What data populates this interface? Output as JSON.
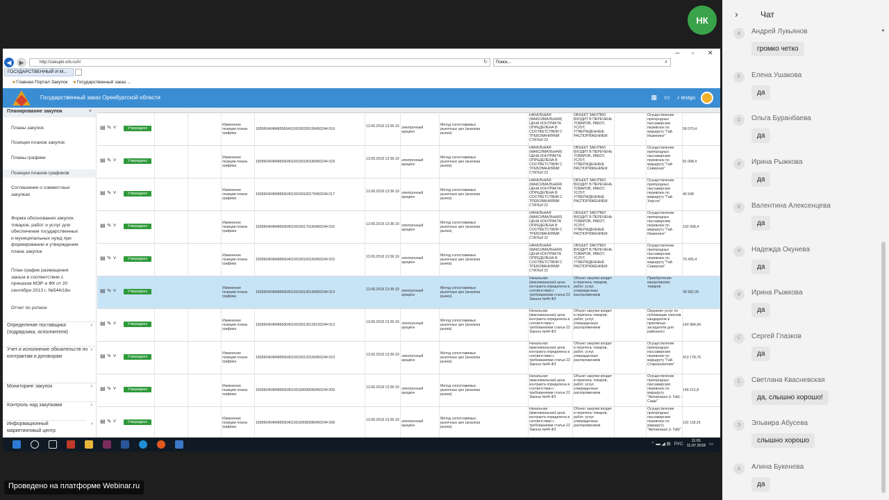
{
  "meeting": {
    "avatar_initials": "НК",
    "platform_label": "Проведено на платформе Webinar.ru"
  },
  "browser": {
    "url": "http://zakupki.orb.ru/#/",
    "search_placeholder": "Поиск...",
    "tabs": [
      "ГОСУДАРСТВЕННЫЙ И М...",
      "Государственный заказ ..."
    ],
    "favorites": [
      "Главная Портал Закупок",
      "Государственный заказ ..."
    ]
  },
  "app": {
    "title": "Государственный заказ Оренбургской области",
    "user": "testgo",
    "sidebar": {
      "group": "Планирование закупок",
      "items": [
        "Планы закупок",
        "Позиции планов закупок",
        "Планы-графики",
        "Позиции планов-графиков",
        "Соглашения о совместных закупках",
        "Форма обоснования закупок товаров, работ и услуг для обеспечения государственных и муниципальных нужд при формировании и утверждении плана закупок",
        "План-график размещения заказа в соответствии с приказом МЭР и ФК от 20 сентября 2013 г. №544/18н",
        "Отчет по рсписи"
      ],
      "sections": [
        "Определение поставщика (подрядчика, исполнителя)",
        "Учет и исполнение обязательств по контрактам и договорам",
        "Мониторинг закупок",
        "Контроль над закупками",
        "Информационный маркетинговый центр"
      ]
    },
    "table_rows": [
      {
        "status": "Утверждено",
        "type": "Изменение позиции плана-графика",
        "number": "183560404848556040100100200190450244 019",
        "date": "13.06.2018 13:36:19",
        "auction": "электронный аукцион",
        "method": "Метод сопоставимых рыночных цен (анализа рынка)",
        "nmc": "НАЧАЛЬНАЯ (МАКСИМАЛЬНАЯ) ЦЕНА КОНТРАКТА ОПРЕДЕЛЕНА В СООТВЕТСТВИИ С ТРЕБОВАНИЯМИ СТАТЬИ 22",
        "object": "ОБЪЕКТ ЗАКУПКИ ВХОДИТ В ПЕРЕЧЕНЬ ТОВАРОВ, РАБОТ, УСЛУГ, УТВЕРЖДЕННЫЕ РАСПОРЯЖЕНИЕМ",
        "desc": "Осуществление пригородных пассажирских перевозок по маршруту \"Гай-Ишкинино\"",
        "sum": "58 070,4"
      },
      {
        "status": "Утверждено",
        "type": "Изменение позиции плана-графика",
        "number": "183560404848556040100100180180450244 018",
        "date": "13.06.2018 13:36:19",
        "auction": "электронный аукцион",
        "method": "Метод сопоставимых рыночных цен (анализа рынка)",
        "nmc": "НАЧАЛЬНАЯ (МАКСИМАЛЬНАЯ) ЦЕНА КОНТРАКТА ОПРЕДЕЛЕНА В СООТВЕТСТВИИ С ТРЕБОВАНИЯМИ СТАТЬИ 22",
        "object": "ОБЪЕКТ ЗАКУПКИ ВХОДИТ В ПЕРЕЧЕНЬ ТОВАРОВ, РАБОТ, УСЛУГ, УТВЕРЖДЕННЫЕ РАСПОРЯЖЕНИЕМ",
        "desc": "Осуществление пригородных пассажирских перевозок по маршруту \"Гай-Северная\"",
        "sum": "81 098,4"
      },
      {
        "status": "Утверждено",
        "type": "Изменение позиции плана-графика",
        "number": "183560404848556040100100180170450244 017",
        "date": "13.06.2018 13:36:19",
        "auction": "электронный аукцион",
        "method": "Метод сопоставимых рыночных цен (анализа рынка)",
        "nmc": "НАЧАЛЬНАЯ (МАКСИМАЛЬНАЯ) ЦЕНА КОНТРАКТА ОПРЕДЕЛЕНА В СООТВЕТСТВИИ С ТРЕБОВАНИЯМИ СТАТЬИ 22",
        "object": "ОБЪЕКТ ЗАКУПКИ ВХОДИТ В ПЕРЕЧЕНЬ ТОВАРОВ, РАБОТ, УСЛУГ, УТВЕРЖДЕННЫЕ РАСПОРЯЖЕНИЕМ",
        "desc": "Осуществление пригородных пассажирских перевозок по маршруту \"Гай-Херсон\"",
        "sum": "46 548"
      },
      {
        "status": "Утверждено",
        "type": "Изменение позиции плана-графика",
        "number": "183560404848556040100100170160450244 016",
        "date": "13.06.2018 13:36:19",
        "auction": "электронный аукцион",
        "method": "Метод сопоставимых рыночных цен (анализа рынка)",
        "nmc": "НАЧАЛЬНАЯ (МАКСИМАЛЬНАЯ) ЦЕНА КОНТРАКТА ОПРЕДЕЛЕНА В СООТВЕТСТВИИ С ТРЕБОВАНИЯМИ СТАТЬИ 22",
        "object": "ОБЪЕКТ ЗАКУПКИ ВХОДИТ В ПЕРЕЧЕНЬ ТОВАРОВ, РАБОТ, УСЛУГ, УТВЕРЖДЕННЫЕ РАСПОРЯЖЕНИЕМ",
        "desc": "Осуществление пригородных пассажирских перевозок по маршруту \"Гай-Ишкинино\"",
        "sum": "102 438,4"
      },
      {
        "status": "Утверждено",
        "type": "Изменение позиции плана-графика",
        "number": "183560404848556040100100160150450244 015",
        "date": "13.06.2018 13:36:19",
        "auction": "электронный аукцион",
        "method": "Метод сопоставимых рыночных цен (анализа рынка)",
        "nmc": "НАЧАЛЬНАЯ (МАКСИМАЛЬНАЯ) ЦЕНА КОНТРАКТА ОПРЕДЕЛЕНА В СООТВЕТСТВИИ С ТРЕБОВАНИЯМИ СТАТЬИ 22",
        "object": "ОБЪЕКТ ЗАКУПКИ ВХОДИТ В ПЕРЕЧЕНЬ ТОВАРОВ, РАБОТ, УСЛУГ, УТВЕРЖДЕННЫЕ РАСПОРЯЖЕНИЕМ",
        "desc": "Осуществление пригородных пассажирских перевозок по маршруту \"Гай-Северная\"",
        "sum": "70 435,4"
      },
      {
        "status": "Утверждено",
        "type": "Изменение позиции плана-графика",
        "number": "183560404848556040100100140140000244 014",
        "date": "13.06.2018 13:36:19",
        "auction": "электронный аукцион",
        "method": "Метод сопоставимых рыночных цен (анализа рынка)",
        "nmc": "Начальная (максимальная) цена контракта определена в соответствии с требованиями статьи 22 Закона №44-ФЗ",
        "object": "Объект закупки входит в перечень товаров, работ, услуг, утвержденные распоряжением",
        "desc": "Приобретение канцелярских товаров",
        "sum": "39 992,35"
      },
      {
        "status": "Утверждено",
        "type": "Изменение позиции плана-графика",
        "number": "183560404848556040100100130130120244 013",
        "date": "13.06.2018 13:36:19",
        "auction": "электронный аукцион",
        "method": "Метод сопоставимых рыночных цен (анализа рынка)",
        "nmc": "Начальная (максимальная) цена контракта определена в соответствии с требованиями статьи 22 Закона №44-ФЗ",
        "object": "Объект закупки входит в перечень товаров, работ, услуг, утвержденные распоряжением",
        "desc": "Оказание услуг по публикации списков кандидатов в присяжных заседатели для районного",
        "sum": "143 984,94"
      },
      {
        "status": "Утверждено",
        "type": "Изменение позиции плана-графика",
        "number": "183560404848556040100100120100450244 010",
        "date": "13.06.2018 13:36:19",
        "auction": "электронный аукцион",
        "method": "Метод сопоставимых рыночных цен (анализа рынка)",
        "nmc": "Начальная (максимальная) цена контракта определена в соответствии с требованиями статьи 22 Закона №44-ФЗ",
        "object": "Объект закупки входит в перечень товаров, работ, услуг, утвержденные распоряжением",
        "desc": "Осуществление пригородных пассажирских перевозок по маршруту \"Гай-Старохалилово\"",
        "sum": "413 178,76"
      },
      {
        "status": "Утверждено",
        "type": "Изменение позиции плана-графика",
        "number": "183560404848556040100100090090450244 009",
        "date": "13.06.2018 13:36:19",
        "auction": "электронный аукцион",
        "method": "Метод сопоставимых рыночных цен (анализа рынка)",
        "nmc": "Начальная (максимальная) цена контракта определена в соответствии с требованиями статьи 22 Закона №44-ФЗ",
        "object": "Объект закупки входит в перечень товаров, работ, услуг, утвержденные распоряжением",
        "desc": "Осуществление пригородных пассажирских перевозок по маршруту \"Автовокзал (г. Гай) - Сады\"",
        "sum": "149 212,8"
      },
      {
        "status": "Утверждено",
        "type": "Изменение позиции плана-графика",
        "number": "183560404848556040100100080080450244 008",
        "date": "13.06.2018 13:36:19",
        "auction": "электронный аукцион",
        "method": "Метод сопоставимых рыночных цен (анализа рынка)",
        "nmc": "Начальная (максимальная) цена контракта определена в соответствии с требованиями статьи 22 Закона №44-ФЗ",
        "object": "Объект закупки входит в перечень товаров, работ, услуг, утвержденные распоряжением",
        "desc": "Осуществление пригородных пассажирских перевозок по маршруту \"Автовокзал (г. Гай)\"",
        "sum": "102 118,25"
      }
    ]
  },
  "taskbar": {
    "lang": "РУС",
    "time": "11:01",
    "date": "11.07.2018"
  },
  "chat": {
    "title": "Чат",
    "messages": [
      {
        "initial": "А",
        "author": "Андрей Лукьянов",
        "text": "громко четко"
      },
      {
        "initial": "Е",
        "author": "Елена Ушакова",
        "text": "да"
      },
      {
        "initial": "О",
        "author": "Ольга Буранбаева",
        "text": "да"
      },
      {
        "initial": "И",
        "author": "Ирина Рыжкова",
        "text": "да"
      },
      {
        "initial": "В",
        "author": "Валентина Алексенцева",
        "text": "да"
      },
      {
        "initial": "Н",
        "author": "Надежда Окунева",
        "text": "да"
      },
      {
        "initial": "И",
        "author": "Ирина Рыжкова",
        "text": "да"
      },
      {
        "initial": "С",
        "author": "Сергей Глазков",
        "text": "да"
      },
      {
        "initial": "С",
        "author": "Светлана Квасневская",
        "text": "да, слышно хорошо!"
      },
      {
        "initial": "Э",
        "author": "Эльвира Абусева",
        "text": "слышно хорошо"
      },
      {
        "initial": "А",
        "author": "Алина Букенева",
        "text": "да"
      }
    ]
  }
}
